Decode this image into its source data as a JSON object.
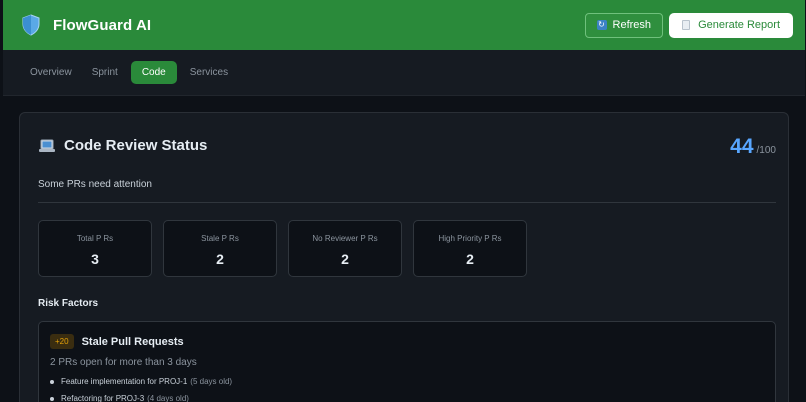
{
  "app": {
    "title": "FlowGuard AI"
  },
  "header": {
    "refresh_label": "Refresh",
    "report_label": "Generate Report"
  },
  "tabs": [
    {
      "label": "Overview",
      "active": false
    },
    {
      "label": "Sprint",
      "active": false
    },
    {
      "label": "Code",
      "active": true
    },
    {
      "label": "Services",
      "active": false
    }
  ],
  "card": {
    "title": "Code Review Status",
    "score": "44",
    "score_max": "/100",
    "subtitle": "Some PRs need attention",
    "stats": [
      {
        "label": "Total P Rs",
        "value": "3"
      },
      {
        "label": "Stale P Rs",
        "value": "2"
      },
      {
        "label": "No Reviewer P Rs",
        "value": "2"
      },
      {
        "label": "High Priority P Rs",
        "value": "2"
      }
    ],
    "risk_heading": "Risk Factors",
    "risk": {
      "badge": "+20",
      "title": "Stale Pull Requests",
      "description": "2 PRs open for more than 3 days",
      "items": [
        {
          "text": "Feature implementation for PROJ-1",
          "age": "(5 days old)"
        },
        {
          "text": "Refactoring for PROJ-3",
          "age": "(4 days old)"
        }
      ]
    }
  },
  "colors": {
    "header_bg": "#2a8a3a",
    "accent_blue": "#58a6ff",
    "badge_amber": "#e3a008",
    "page_bg": "#0d1117"
  },
  "icons": {
    "brand": "shield-icon",
    "refresh": "refresh-icon",
    "report": "document-icon",
    "card": "laptop-icon"
  }
}
